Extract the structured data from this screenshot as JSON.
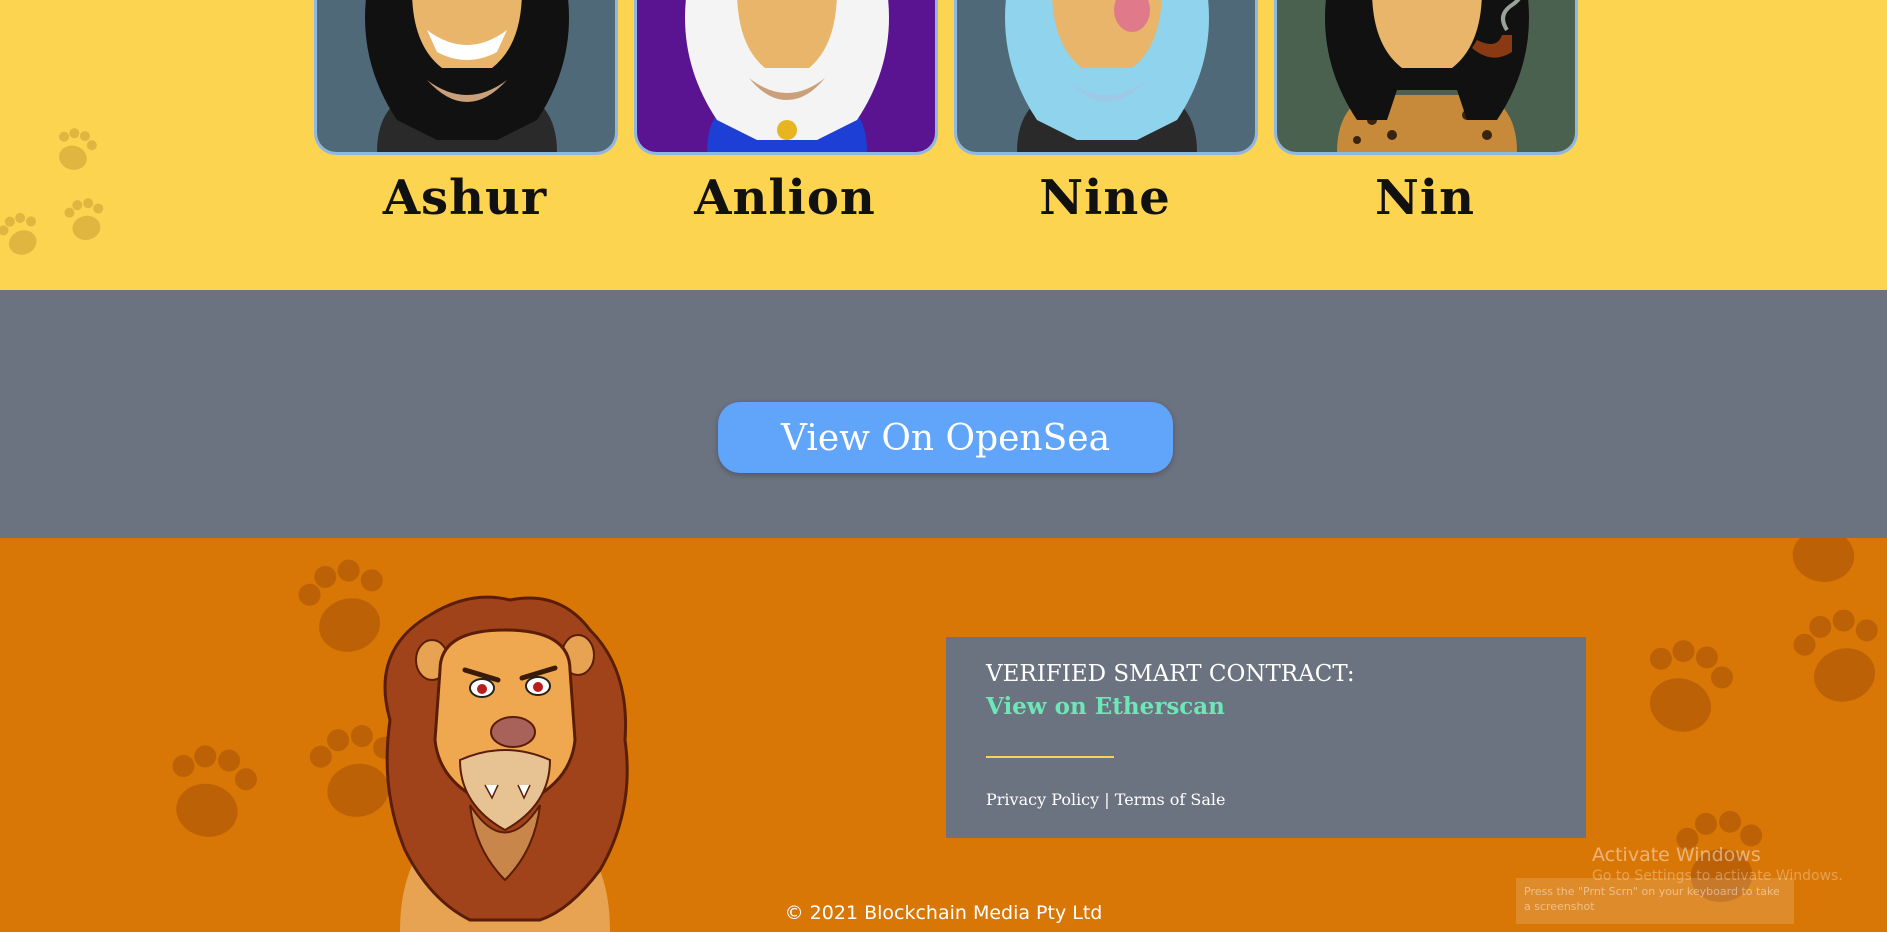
{
  "team": {
    "members": [
      {
        "name": "Ashur",
        "bg": "#4f6978",
        "mane": "#111111"
      },
      {
        "name": "Anlion",
        "bg": "#5b1491",
        "mane": "#f4f4f4"
      },
      {
        "name": "Nine",
        "bg": "#4f6978",
        "mane": "#8fd4ec"
      },
      {
        "name": "Nin",
        "bg": "#4b6150",
        "mane": "#111111"
      }
    ]
  },
  "cta": {
    "button_label": "View On OpenSea"
  },
  "footer": {
    "contract_title": "VERIFIED SMART CONTRACT:",
    "etherscan_label": "View on Etherscan",
    "privacy_label": "Privacy Policy",
    "separator": "|",
    "terms_label": "Terms of Sale",
    "copyright": "© 2021 Blockchain Media Pty Ltd"
  },
  "os_overlay": {
    "activate_title": "Activate Windows",
    "activate_sub": "Go to Settings to activate Windows.",
    "toast": "Press the \"Prnt Scrn\" on your keyboard to take a screenshot"
  },
  "colors": {
    "team_bg": "#fdd450",
    "cta_bg": "#6b7280",
    "button": "#60a5fa",
    "footer_bg": "#d97706",
    "etherscan_link": "#6ee7b7",
    "divider": "#fcd34d"
  },
  "icons": [
    "paw-print-icon",
    "lion-mascot-illustration"
  ]
}
